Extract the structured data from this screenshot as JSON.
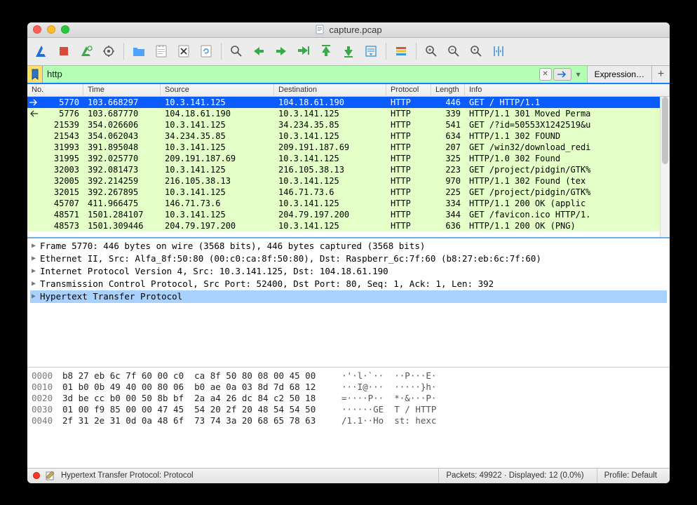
{
  "title": "capture.pcap",
  "filter": {
    "value": "http",
    "expression_label": "Expression…"
  },
  "columns": {
    "no": "No.",
    "time": "Time",
    "src": "Source",
    "dst": "Destination",
    "proto": "Protocol",
    "len": "Length",
    "info": "Info"
  },
  "packets": [
    {
      "mark": "start",
      "no": "5770",
      "time": "103.668297",
      "src": "10.3.141.125",
      "dst": "104.18.61.190",
      "proto": "HTTP",
      "len": "446",
      "info": "GET / HTTP/1.1",
      "sel": true
    },
    {
      "mark": "end",
      "no": "5776",
      "time": "103.687770",
      "src": "104.18.61.190",
      "dst": "10.3.141.125",
      "proto": "HTTP",
      "len": "339",
      "info": "HTTP/1.1 301 Moved Perma"
    },
    {
      "no": "21539",
      "time": "354.026606",
      "src": "10.3.141.125",
      "dst": "34.234.35.85",
      "proto": "HTTP",
      "len": "541",
      "info": "GET /?id=50553X1242519&u"
    },
    {
      "no": "21543",
      "time": "354.062043",
      "src": "34.234.35.85",
      "dst": "10.3.141.125",
      "proto": "HTTP",
      "len": "634",
      "info": "HTTP/1.1 302 FOUND"
    },
    {
      "no": "31993",
      "time": "391.895048",
      "src": "10.3.141.125",
      "dst": "209.191.187.69",
      "proto": "HTTP",
      "len": "207",
      "info": "GET /win32/download_redi"
    },
    {
      "no": "31995",
      "time": "392.025770",
      "src": "209.191.187.69",
      "dst": "10.3.141.125",
      "proto": "HTTP",
      "len": "325",
      "info": "HTTP/1.0 302 Found"
    },
    {
      "no": "32003",
      "time": "392.081473",
      "src": "10.3.141.125",
      "dst": "216.105.38.13",
      "proto": "HTTP",
      "len": "223",
      "info": "GET /project/pidgin/GTK%"
    },
    {
      "no": "32005",
      "time": "392.214259",
      "src": "216.105.38.13",
      "dst": "10.3.141.125",
      "proto": "HTTP",
      "len": "970",
      "info": "HTTP/1.1 302 Found  (tex"
    },
    {
      "no": "32015",
      "time": "392.267895",
      "src": "10.3.141.125",
      "dst": "146.71.73.6",
      "proto": "HTTP",
      "len": "225",
      "info": "GET /project/pidgin/GTK%"
    },
    {
      "no": "45707",
      "time": "411.966475",
      "src": "146.71.73.6",
      "dst": "10.3.141.125",
      "proto": "HTTP",
      "len": "334",
      "info": "HTTP/1.1 200 OK  (applic"
    },
    {
      "no": "48571",
      "time": "1501.284107",
      "src": "10.3.141.125",
      "dst": "204.79.197.200",
      "proto": "HTTP",
      "len": "344",
      "info": "GET /favicon.ico HTTP/1."
    },
    {
      "no": "48573",
      "time": "1501.309446",
      "src": "204.79.197.200",
      "dst": "10.3.141.125",
      "proto": "HTTP",
      "len": "636",
      "info": "HTTP/1.1 200 OK  (PNG)"
    }
  ],
  "details": [
    {
      "label": "Frame 5770: 446 bytes on wire (3568 bits), 446 bytes captured (3568 bits)"
    },
    {
      "label": "Ethernet II, Src: Alfa_8f:50:80 (00:c0:ca:8f:50:80), Dst: Raspberr_6c:7f:60 (b8:27:eb:6c:7f:60)"
    },
    {
      "label": "Internet Protocol Version 4, Src: 10.3.141.125, Dst: 104.18.61.190"
    },
    {
      "label": "Transmission Control Protocol, Src Port: 52400, Dst Port: 80, Seq: 1, Ack: 1, Len: 392"
    },
    {
      "label": "Hypertext Transfer Protocol",
      "sel": true
    }
  ],
  "hex": [
    {
      "off": "0000",
      "b": "b8 27 eb 6c 7f 60 00 c0  ca 8f 50 80 08 00 45 00",
      "a": "·'·l·`··  ··P···E·"
    },
    {
      "off": "0010",
      "b": "01 b0 0b 49 40 00 80 06  b0 ae 0a 03 8d 7d 68 12",
      "a": "···I@···  ·····}h·"
    },
    {
      "off": "0020",
      "b": "3d be cc b0 00 50 8b bf  2a a4 26 dc 84 c2 50 18",
      "a": "=····P··  *·&···P·"
    },
    {
      "off": "0030",
      "b": "01 00 f9 85 00 00 47 45  54 20 2f 20 48 54 54 50",
      "a": "······GE  T / HTTP"
    },
    {
      "off": "0040",
      "b": "2f 31 2e 31 0d 0a 48 6f  73 74 3a 20 68 65 78 63",
      "a": "/1.1··Ho  st: hexc"
    }
  ],
  "status": {
    "selection": "Hypertext Transfer Protocol: Protocol",
    "counts": "Packets: 49922 · Displayed: 12 (0.0%)",
    "profile": "Profile: Default"
  }
}
